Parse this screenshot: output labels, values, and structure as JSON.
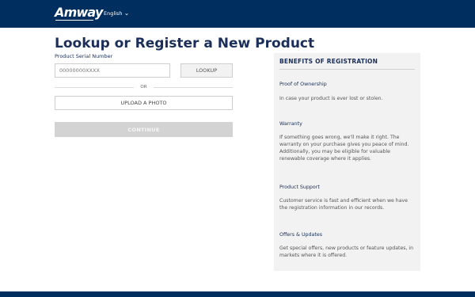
{
  "header": {
    "logo_text": "Amway",
    "language_label": "English",
    "brand_color": "#002f5f"
  },
  "main": {
    "title": "Lookup or Register a New Product",
    "serial_label": "Product Serial Number",
    "serial_placeholder": "00000000XXXX",
    "lookup_label": "LOOKUP",
    "or_label": "OR",
    "upload_label": "UPLOAD A PHOTO",
    "continue_label": "CONTINUE"
  },
  "benefits": {
    "title": "BENEFITS OF REGISTRATION",
    "items": [
      {
        "heading": "Proof of Ownership",
        "text": "In case your product is ever lost or stolen."
      },
      {
        "heading": "Warranty",
        "text": "If something goes wrong, we'll make it right. The warranty on your purchase gives you peace of mind. Additionally, you may be eligible for valuable renewable coverage where it applies."
      },
      {
        "heading": "Product Support",
        "text": "Customer service is fast and efficient when we have the registration information in our records."
      },
      {
        "heading": "Offers & Updates",
        "text": "Get special offers, new products or feature updates, in markets where it is offered."
      }
    ]
  },
  "icons": {
    "language_dropdown": "chevron-down-icon"
  }
}
